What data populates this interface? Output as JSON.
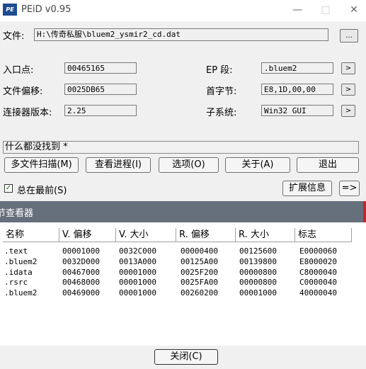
{
  "window": {
    "title": "PEiD v0.95",
    "icon_text": "PE",
    "minimize_icon": "—",
    "maximize_icon": "□",
    "close_icon": "✕"
  },
  "file": {
    "label": "文件:",
    "path": "H:\\传奇私服\\bluem2_ysmir2_cd.dat",
    "browse_label": "..."
  },
  "fields": {
    "entry_point_label": "入口点:",
    "entry_point": "00465165",
    "file_offset_label": "文件偏移:",
    "file_offset": "0025DB65",
    "linker_label": "连接器版本:",
    "linker": "2.25",
    "ep_section_label": "EP 段:",
    "ep_section": ".bluem2",
    "first_bytes_label": "首字节:",
    "first_bytes": "E8,1D,00,00",
    "subsystem_label": "子系统:",
    "subsystem": "Win32 GUI",
    "arrow": ">"
  },
  "status": {
    "text": "什么都没找到  *"
  },
  "buttons": {
    "multi_scan": "多文件扫描(M)",
    "task_viewer": "查看进程(I)",
    "options": "选项(O)",
    "about": "关于(A)",
    "exit": "退出",
    "plugins": "扩展信息",
    "more": "=>",
    "close": "关闭(C)"
  },
  "stay_on_top": {
    "label": "总在最前(S)",
    "checked_mark": "✓"
  },
  "section_viewer": {
    "title": "节查看器",
    "columns": [
      "名称",
      "V. 偏移",
      "V. 大小",
      "R. 偏移",
      "R. 大小",
      "标志"
    ],
    "rows": [
      [
        ".text",
        "00001000",
        "0032C000",
        "00000400",
        "00125600",
        "E0000060"
      ],
      [
        ".bluem2",
        "0032D000",
        "0013A000",
        "00125A00",
        "00139800",
        "E8000020"
      ],
      [
        ".idata",
        "00467000",
        "00001000",
        "0025F200",
        "00000800",
        "C8000040"
      ],
      [
        ".rsrc",
        "00468000",
        "00001000",
        "0025FA00",
        "00000800",
        "C0000040"
      ],
      [
        ".bluem2",
        "00469000",
        "00001000",
        "00260200",
        "00001000",
        "40000040"
      ]
    ]
  },
  "colors": {
    "section_header_bg": "#666f7c",
    "accent_red": "#c1272d",
    "window_bg": "#f0f0f0"
  }
}
